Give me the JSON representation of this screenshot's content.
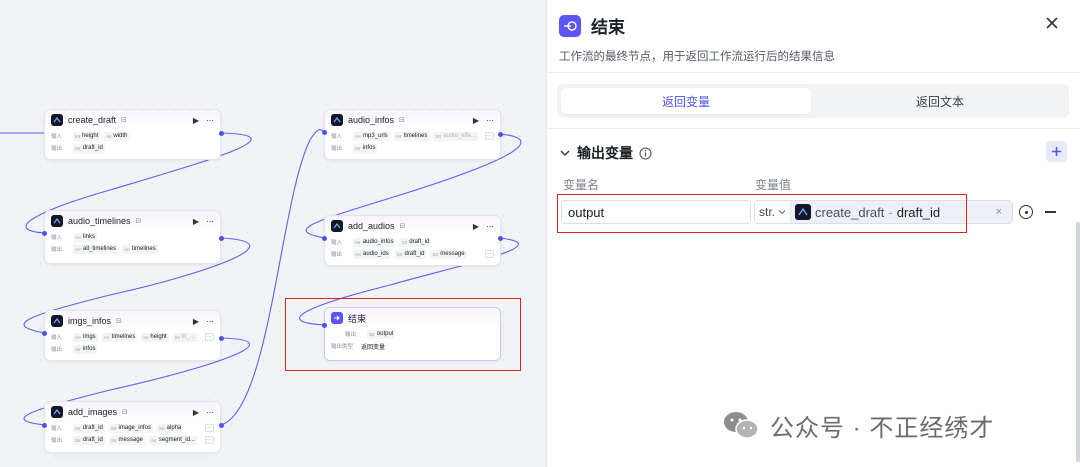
{
  "nodes": {
    "create_draft": {
      "title": "create_draft",
      "input_label": "输入",
      "output_label": "输出",
      "inputs": [
        {
          "type": "Int",
          "name": "height"
        },
        {
          "type": "Int",
          "name": "width"
        }
      ],
      "outputs": [
        {
          "type": "Str",
          "name": "draft_id"
        }
      ]
    },
    "audio_timelines": {
      "title": "audio_timelines",
      "input_label": "输入",
      "output_label": "输出",
      "inputs": [
        {
          "type": "Arr",
          "name": "links"
        }
      ],
      "outputs": [
        {
          "type": "Arr",
          "name": "all_timelines"
        },
        {
          "type": "Arr",
          "name": "timelines"
        }
      ]
    },
    "imgs_infos": {
      "title": "imgs_infos",
      "input_label": "输入",
      "output_label": "输出",
      "inputs": [
        {
          "type": "Arr",
          "name": "imgs"
        },
        {
          "type": "Arr",
          "name": "timelines"
        },
        {
          "type": "Int",
          "name": "height"
        },
        {
          "type": "Int",
          "name": "in_..."
        }
      ],
      "outputs": [
        {
          "type": "Str",
          "name": "infos"
        }
      ]
    },
    "add_images": {
      "title": "add_images",
      "input_label": "输入",
      "output_label": "输出",
      "inputs": [
        {
          "type": "Str",
          "name": "draft_id"
        },
        {
          "type": "Str",
          "name": "image_infos"
        },
        {
          "type": "Str",
          "name": "alpha"
        }
      ],
      "outputs": [
        {
          "type": "Str",
          "name": "draft_id"
        },
        {
          "type": "Str",
          "name": "message"
        },
        {
          "type": "Arr",
          "name": "segment_id..."
        }
      ]
    },
    "audio_infos": {
      "title": "audio_infos",
      "input_label": "输入",
      "output_label": "输出",
      "inputs": [
        {
          "type": "Arr",
          "name": "mp3_urls"
        },
        {
          "type": "Arr",
          "name": "timelines"
        },
        {
          "type": "Str",
          "name": "audio_effe..."
        }
      ],
      "outputs": [
        {
          "type": "Str",
          "name": "infos"
        }
      ]
    },
    "add_audios": {
      "title": "add_audios",
      "input_label": "输入",
      "output_label": "输出",
      "inputs": [
        {
          "type": "Str",
          "name": "audio_infos"
        },
        {
          "type": "Str",
          "name": "draft_id"
        }
      ],
      "outputs": [
        {
          "type": "Arr",
          "name": "audio_ids"
        },
        {
          "type": "Str",
          "name": "draft_id"
        },
        {
          "type": "Str",
          "name": "message"
        }
      ]
    },
    "end": {
      "title": "结束",
      "output_label": "输出",
      "output_type_label": "输出类型",
      "outputs": [
        {
          "type": "Str",
          "name": "output"
        }
      ],
      "output_type": "返回变量"
    }
  },
  "panel": {
    "title": "结束",
    "description": "工作流的最终节点，用于返回工作流运行后的结果信息",
    "tabs": [
      {
        "label": "返回变量",
        "active": true
      },
      {
        "label": "返回文本",
        "active": false
      }
    ],
    "section_title": "输出变量",
    "col_name": "变量名",
    "col_value": "变量值",
    "variable": {
      "name": "output",
      "type": "str.",
      "ref_source": "create_draft",
      "ref_sep": "-",
      "ref_field": "draft_id"
    }
  },
  "watermark": "公众号 · 不正经绣才",
  "colors": {
    "accent": "#4d53e8",
    "end_icon": "#5a55f3",
    "highlight": "#e02424"
  }
}
